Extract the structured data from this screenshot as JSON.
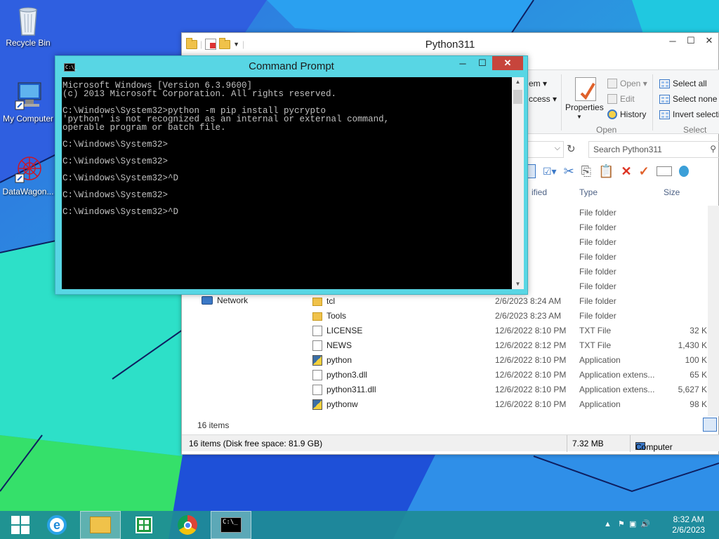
{
  "desktop": {
    "icons": [
      {
        "label": "Recycle Bin",
        "icon": "recycle-bin-icon"
      },
      {
        "label": "My Computer",
        "icon": "computer-icon"
      },
      {
        "label": "DataWagon...",
        "icon": "datawagon-icon"
      }
    ]
  },
  "explorer": {
    "title": "Python311",
    "ribbon": {
      "partial_left": [
        "em ▾",
        "ccess ▾"
      ],
      "properties_label": "Properties",
      "open_label": "Open ▾",
      "edit_label": "Edit",
      "history_label": "History",
      "open_group": "Open",
      "select_all": "Select all",
      "select_none": "Select none",
      "invert_selection": "Invert selectio",
      "select_group": "Select"
    },
    "search_placeholder": "Search Python311",
    "columns": {
      "modified": "ified",
      "type": "Type",
      "size": "Size"
    },
    "rows": [
      {
        "name": "",
        "date": "8:24 AM",
        "type": "File folder",
        "size": "",
        "icon": "folder"
      },
      {
        "name": "",
        "date": "8:23 AM",
        "type": "File folder",
        "size": "",
        "icon": "folder"
      },
      {
        "name": "",
        "date": "8:23 AM",
        "type": "File folder",
        "size": "",
        "icon": "folder"
      },
      {
        "name": "",
        "date": "8:23 AM",
        "type": "File folder",
        "size": "",
        "icon": "folder"
      },
      {
        "name": "",
        "date": "8:23 AM",
        "type": "File folder",
        "size": "",
        "icon": "folder"
      },
      {
        "name": "",
        "date": "8:24 AM",
        "type": "File folder",
        "size": "",
        "icon": "folder"
      },
      {
        "name": "tcl",
        "date": "2/6/2023 8:24 AM",
        "type": "File folder",
        "size": "",
        "icon": "folder"
      },
      {
        "name": "Tools",
        "date": "2/6/2023 8:23 AM",
        "type": "File folder",
        "size": "",
        "icon": "folder"
      },
      {
        "name": "LICENSE",
        "date": "12/6/2022 8:10 PM",
        "type": "TXT File",
        "size": "32 KB",
        "icon": "doc"
      },
      {
        "name": "NEWS",
        "date": "12/6/2022 8:12 PM",
        "type": "TXT File",
        "size": "1,430 KB",
        "icon": "doc"
      },
      {
        "name": "python",
        "date": "12/6/2022 8:10 PM",
        "type": "Application",
        "size": "100 KB",
        "icon": "py"
      },
      {
        "name": "python3.dll",
        "date": "12/6/2022 8:10 PM",
        "type": "Application extens...",
        "size": "65 KB",
        "icon": "dll"
      },
      {
        "name": "python311.dll",
        "date": "12/6/2022 8:10 PM",
        "type": "Application extens...",
        "size": "5,627 KB",
        "icon": "dll"
      },
      {
        "name": "pythonw",
        "date": "12/6/2022 8:10 PM",
        "type": "Application",
        "size": "98 KB",
        "icon": "py"
      }
    ],
    "nav_network": "Network",
    "item_count": "16 items",
    "status": {
      "left": "16 items (Disk free space: 81.9 GB)",
      "size": "7.32 MB",
      "location": "Computer"
    }
  },
  "cmd": {
    "title": "Command Prompt",
    "lines": [
      "Microsoft Windows [Version 6.3.9600]",
      "(c) 2013 Microsoft Corporation. All rights reserved.",
      "",
      "C:\\Windows\\System32>python -m pip install pycrypto",
      "'python' is not recognized as an internal or external command,",
      "operable program or batch file.",
      "",
      "C:\\Windows\\System32>",
      "",
      "C:\\Windows\\System32>",
      "",
      "C:\\Windows\\System32>^D",
      "",
      "C:\\Windows\\System32>",
      "",
      "C:\\Windows\\System32>^D"
    ]
  },
  "taskbar": {
    "clock_time": "8:32 AM",
    "clock_date": "2/6/2023"
  }
}
